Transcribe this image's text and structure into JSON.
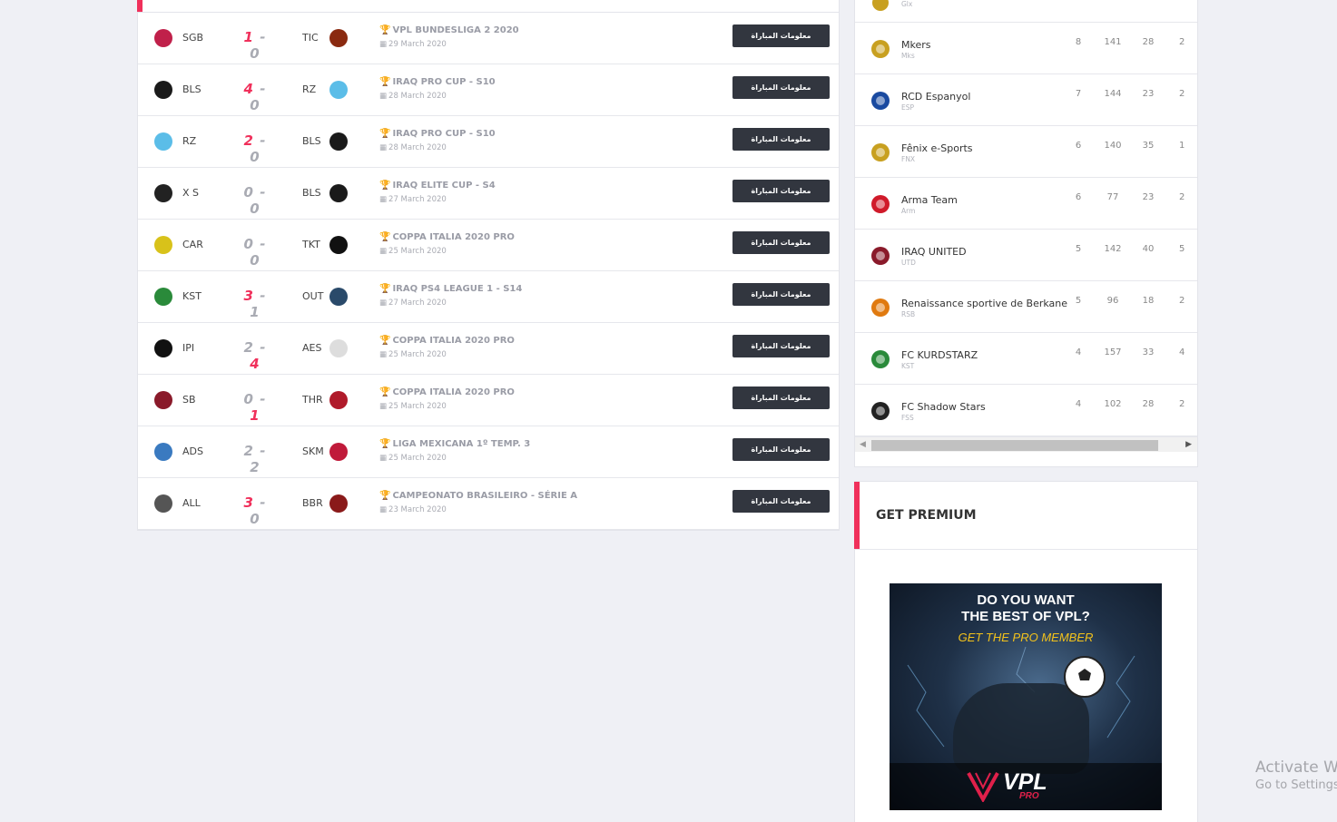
{
  "matches": [
    {
      "home": "SGB",
      "home_score": "1",
      "away_score": "0",
      "winner": "home",
      "away": "TIC",
      "competition": "VPL BUNDESLIGA 2 2020",
      "date": "29 March 2020",
      "button": "معلومات المباراة",
      "home_color": "#c0204a",
      "away_color": "#8a2a10"
    },
    {
      "home": "BLS",
      "home_score": "4",
      "away_score": "0",
      "winner": "home",
      "away": "RZ",
      "competition": "IRAQ PRO CUP - S10",
      "date": "28 March 2020",
      "button": "معلومات المباراة",
      "home_color": "#1a1a1a",
      "away_color": "#5bbde8"
    },
    {
      "home": "RZ",
      "home_score": "2",
      "away_score": "0",
      "winner": "home",
      "away": "BLS",
      "competition": "IRAQ PRO CUP - S10",
      "date": "28 March 2020",
      "button": "معلومات المباراة",
      "home_color": "#5bbde8",
      "away_color": "#1a1a1a"
    },
    {
      "home": "X S",
      "home_score": "0",
      "away_score": "0",
      "winner": "none",
      "away": "BLS",
      "competition": "IRAQ ELITE CUP - S4",
      "date": "27 March 2020",
      "button": "معلومات المباراة",
      "home_color": "#222222",
      "away_color": "#1a1a1a"
    },
    {
      "home": "CAR",
      "home_score": "0",
      "away_score": "0",
      "winner": "none",
      "away": "TKT",
      "competition": "COPPA ITALIA 2020 PRO",
      "date": "25 March 2020",
      "button": "معلومات المباراة",
      "home_color": "#d8c21a",
      "away_color": "#111111"
    },
    {
      "home": "KST",
      "home_score": "3",
      "away_score": "1",
      "winner": "home",
      "away": "OUT",
      "competition": "IRAQ PS4 LEAGUE 1 - S14",
      "date": "27 March 2020",
      "button": "معلومات المباراة",
      "home_color": "#2a8a3a",
      "away_color": "#2a4a6a"
    },
    {
      "home": "IPI",
      "home_score": "2",
      "away_score": "4",
      "winner": "away",
      "away": "AES",
      "competition": "COPPA ITALIA 2020 PRO",
      "date": "25 March 2020",
      "button": "معلومات المباراة",
      "home_color": "#111111",
      "away_color": "#dddddd"
    },
    {
      "home": "SB",
      "home_score": "0",
      "away_score": "1",
      "winner": "away",
      "away": "THR",
      "competition": "COPPA ITALIA 2020 PRO",
      "date": "25 March 2020",
      "button": "معلومات المباراة",
      "home_color": "#8a1a2a",
      "away_color": "#b01a2a"
    },
    {
      "home": "ADS",
      "home_score": "2",
      "away_score": "2",
      "winner": "none",
      "away": "SKM",
      "competition": "LIGA MEXICANA 1º TEMP. 3",
      "date": "25 March 2020",
      "button": "معلومات المباراة",
      "home_color": "#3a7ac0",
      "away_color": "#c01a3a"
    },
    {
      "home": "ALL",
      "home_score": "3",
      "away_score": "0",
      "winner": "home",
      "away": "BBR",
      "competition": "CAMPEONATO BRASILEIRO - SÉRIE A",
      "date": "23 March 2020",
      "button": "معلومات المباراة",
      "home_color": "#555555",
      "away_color": "#8a1a1a"
    }
  ],
  "standings": {
    "partial_top": {
      "abbr": "Glx"
    },
    "rows": [
      {
        "name": "Mkers",
        "abbr": "Mks",
        "c1": "8",
        "c2": "141",
        "c3": "28",
        "c4": "2",
        "color": "#c8a020"
      },
      {
        "name": "RCD Espanyol",
        "abbr": "ESP",
        "c1": "7",
        "c2": "144",
        "c3": "23",
        "c4": "2",
        "color": "#1a4aa0"
      },
      {
        "name": "Fênix e-Sports",
        "abbr": "FNX",
        "c1": "6",
        "c2": "140",
        "c3": "35",
        "c4": "1",
        "color": "#c8a020"
      },
      {
        "name": "Arma Team",
        "abbr": "Arm",
        "c1": "6",
        "c2": "77",
        "c3": "23",
        "c4": "2",
        "color": "#d01a2a"
      },
      {
        "name": "IRAQ UNITED",
        "abbr": "UTD",
        "c1": "5",
        "c2": "142",
        "c3": "40",
        "c4": "5",
        "color": "#8a1a2a"
      },
      {
        "name": "Renaissance sportive de Berkane",
        "abbr": "RSB",
        "c1": "5",
        "c2": "96",
        "c3": "18",
        "c4": "2",
        "color": "#e07a10"
      },
      {
        "name": "FC KURDSTARZ",
        "abbr": "KST",
        "c1": "4",
        "c2": "157",
        "c3": "33",
        "c4": "4",
        "color": "#2a8a3a"
      },
      {
        "name": "FC Shadow Stars",
        "abbr": "FSS",
        "c1": "4",
        "c2": "102",
        "c3": "28",
        "c4": "2",
        "color": "#222222"
      }
    ]
  },
  "premium": {
    "title": "GET PREMIUM",
    "ad_line1": "DO YOU WANT",
    "ad_line2": "THE BEST OF VPL?",
    "ad_line3": "GET THE PRO MEMBER",
    "ad_brand": "VPL",
    "ad_pro": "PRO"
  },
  "watermark": {
    "line1": "Activate W",
    "line2": "Go to Settings"
  },
  "colors": {
    "accent": "#f0305b",
    "button": "#32363f"
  }
}
